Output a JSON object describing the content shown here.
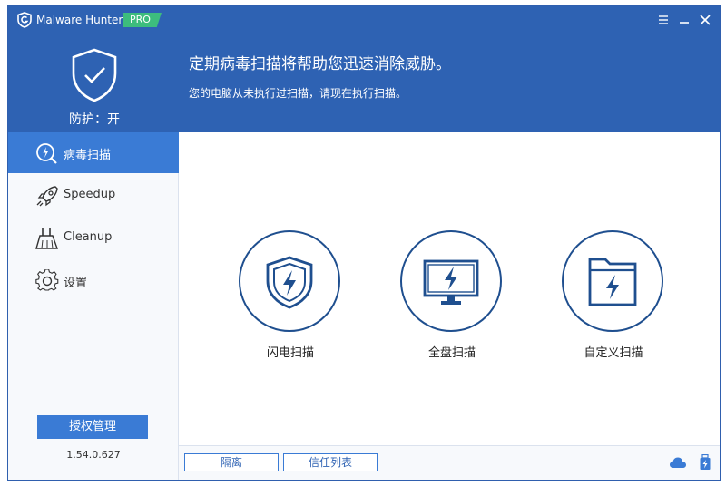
{
  "app": {
    "title": "Malware Hunter",
    "badge": "PRO",
    "colors": {
      "header": "#2e62b3",
      "accent": "#3a7bd5",
      "badge": "#3dbd7d",
      "icon": "#1f4f8f"
    }
  },
  "window_controls": {
    "menu_icon": "menu-icon",
    "minimize_icon": "minimize-icon",
    "close_icon": "close-icon"
  },
  "header": {
    "protection_status": "防护：开",
    "headline": "定期病毒扫描将帮助您迅速消除威胁。",
    "subline": "您的电脑从未执行过扫描，请现在执行扫描。"
  },
  "sidebar": {
    "items": [
      {
        "label": "病毒扫描",
        "icon": "virus-scan-icon",
        "active": true
      },
      {
        "label": "Speedup",
        "icon": "rocket-icon",
        "active": false
      },
      {
        "label": "Cleanup",
        "icon": "broom-icon",
        "active": false
      },
      {
        "label": "设置",
        "icon": "gear-icon",
        "active": false
      }
    ],
    "license_button": "授权管理",
    "version": "1.54.0.627"
  },
  "scan_options": [
    {
      "label": "闪电扫描",
      "icon": "shield-bolt-icon"
    },
    {
      "label": "全盘扫描",
      "icon": "monitor-bolt-icon"
    },
    {
      "label": "自定义扫描",
      "icon": "folder-bolt-icon"
    }
  ],
  "footer": {
    "quarantine_button": "隔离",
    "trust_list_button": "信任列表",
    "cloud_icon": "cloud-icon",
    "usb_icon": "usb-bolt-icon"
  }
}
